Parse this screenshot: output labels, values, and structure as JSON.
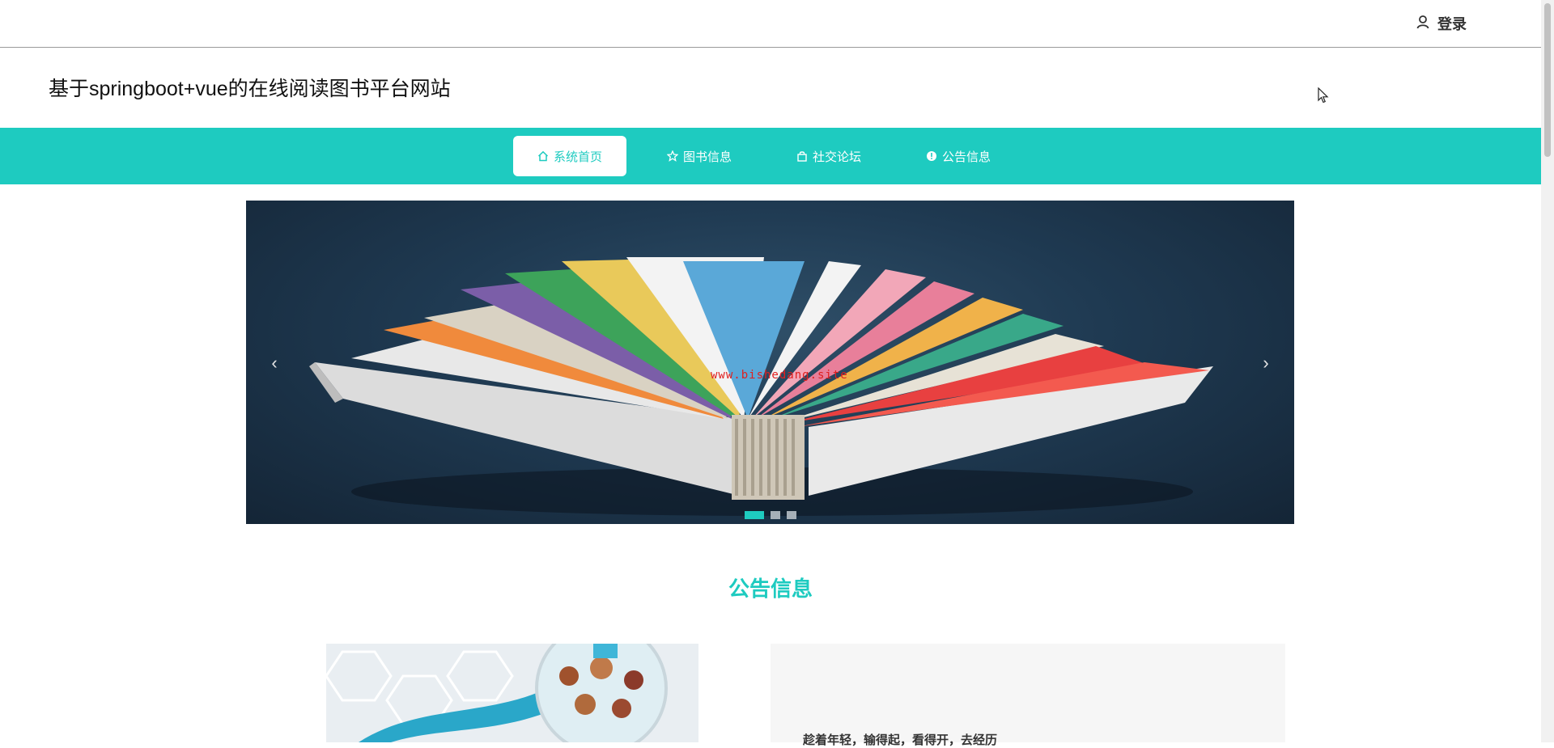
{
  "header": {
    "login_label": "登录",
    "login_icon": "user-icon"
  },
  "site": {
    "title": "基于springboot+vue的在线阅读图书平台网站"
  },
  "nav": {
    "items": [
      {
        "label": "系统首页",
        "icon": "home-icon",
        "active": true
      },
      {
        "label": "图书信息",
        "icon": "star-icon",
        "active": false
      },
      {
        "label": "社交论坛",
        "icon": "bag-icon",
        "active": false
      },
      {
        "label": "公告信息",
        "icon": "info-icon",
        "active": false
      }
    ]
  },
  "carousel": {
    "watermark": "www.bishedang.site",
    "prev_glyph": "‹",
    "next_glyph": "›",
    "slide_count": 3,
    "active_slide": 1
  },
  "section": {
    "title": "公告信息"
  },
  "notice": {
    "first_line": "趁着年轻，输得起，看得开，去经历"
  },
  "colors": {
    "accent": "#1ecbc0",
    "watermark": "#e02020"
  }
}
